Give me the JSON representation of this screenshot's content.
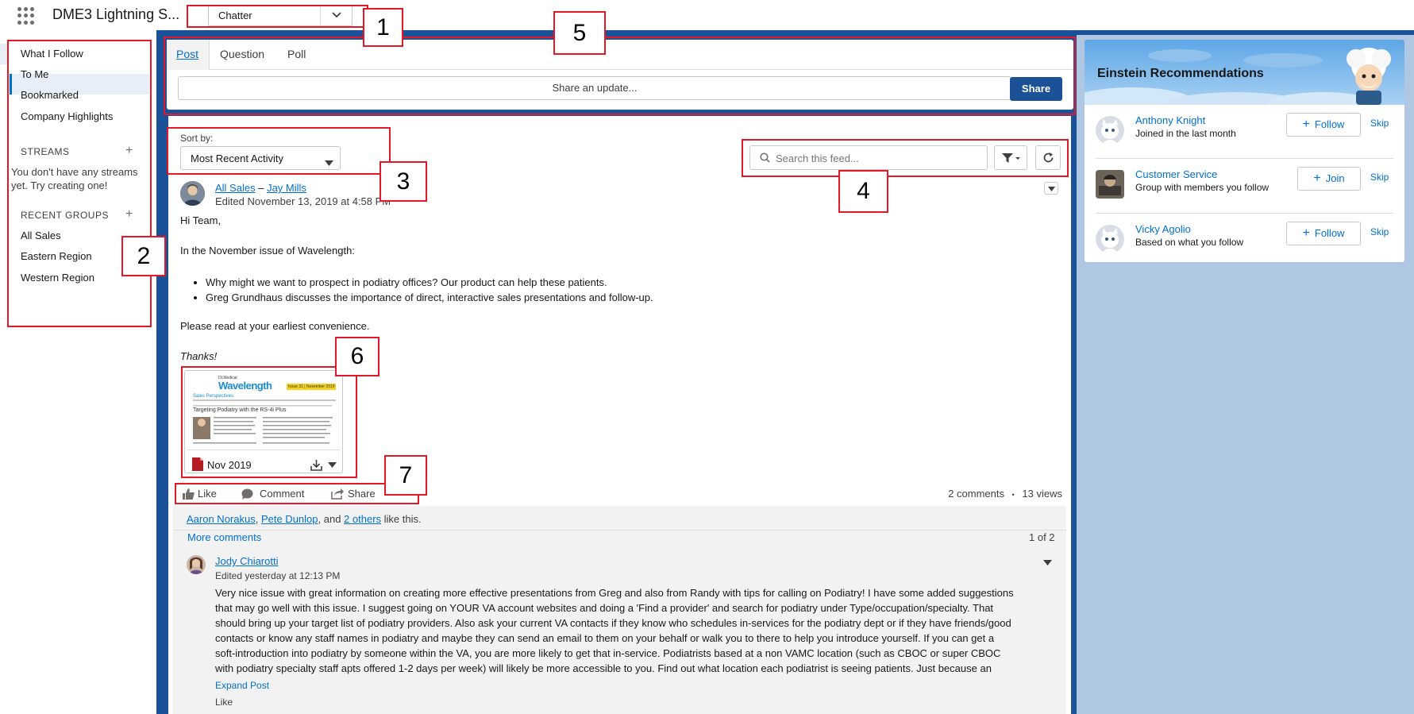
{
  "topbar": {
    "app_name": "DME3 Lightning S...",
    "nav_value": "Chatter"
  },
  "sidebar": {
    "items": [
      {
        "label": "What I Follow"
      },
      {
        "label": "To Me"
      },
      {
        "label": "Bookmarked"
      },
      {
        "label": "Company Highlights"
      }
    ],
    "streams_heading": "STREAMS",
    "streams_note": "You don't have any streams yet. Try creating one!",
    "groups_heading": "RECENT GROUPS",
    "groups": [
      {
        "label": "All Sales"
      },
      {
        "label": "Eastern Region"
      },
      {
        "label": "Western Region"
      }
    ]
  },
  "publisher": {
    "tabs": [
      {
        "label": "Post"
      },
      {
        "label": "Question"
      },
      {
        "label": "Poll"
      }
    ],
    "placeholder": "Share an update...",
    "share_label": "Share"
  },
  "feed": {
    "sort_label": "Sort by:",
    "sort_value": "Most Recent Activity",
    "search_placeholder": "Search this feed..."
  },
  "post": {
    "group": "All Sales",
    "dash": "–",
    "author": "Jay Mills",
    "edited": "Edited November 13, 2019 at 4:58 PM",
    "greeting": "Hi Team,",
    "intro": "In the November issue of Wavelength:",
    "bullets": [
      "Why might we want to prospect in podiatry offices? Our product can help these patients.",
      "Greg Grundhaus discusses the importance of direct, interactive sales presentations and follow-up."
    ],
    "closing": "Please read at your earliest convenience.",
    "thanks": "Thanks!",
    "attachment": {
      "name": "Nov 2019",
      "brand": "Wavelength",
      "company": "DLMedical",
      "issue": "Issue 31 | November 2019",
      "section": "Sales Perspectives",
      "headline": "Targeting Podiatry with the RS-4i Plus"
    },
    "actions": {
      "like": "Like",
      "comment": "Comment",
      "share": "Share"
    },
    "comments_count": "2 comments",
    "views_count": "13 views",
    "stats_sep": "•"
  },
  "likes": {
    "person1": "Aaron Norakus",
    "person2": "Pete Dunlop",
    "mid": ", and ",
    "others": "2 others",
    "suffix": " like this."
  },
  "comments": {
    "more_label": "More comments",
    "pager": "1 of 2",
    "first": {
      "author": "Jody Chiarotti",
      "edited": "Edited yesterday at 12:13 PM",
      "lines": [
        "Very nice issue with great information on creating more effective presentations from Greg and also from Randy with tips for calling on Podiatry! I have some added suggestions",
        "that may go well with this issue. I suggest going on YOUR VA account websites and doing a 'Find a provider' and search for podiatry under Type/occupation/specialty. That",
        "should bring up your target list of podiatry providers. Also ask your current VA contacts if they know who schedules in-services for the podiatry dept or if they have friends/good",
        "contacts or know any staff names in podiatry and maybe they can send an email to them on your behalf or walk you to there to help you introduce yourself. If you can get a",
        "soft-introduction into podiatry by someone within the VA, you are more likely to get that in-service. Podiatrists based at a non VAMC location (such as CBOC or super CBOC",
        "with podiatry specialty staff apts offered 1-2 days per week) will likely be more accessible to you. Find out what location each podiatrist is seeing patients. Just because an"
      ],
      "expand_label": "Expand Post",
      "like_label": "Like"
    }
  },
  "einstein": {
    "title": "Einstein Recommendations",
    "recs": [
      {
        "name": "Anthony Knight",
        "sub": "Joined in the last month",
        "action": "Follow",
        "skip": "Skip"
      },
      {
        "name": "Customer Service",
        "sub": "Group with members you follow",
        "action": "Join",
        "skip": "Skip"
      },
      {
        "name": "Vicky Agolio",
        "sub": "Based on what you follow",
        "action": "Follow",
        "skip": "Skip"
      }
    ]
  },
  "callouts": [
    "1",
    "2",
    "3",
    "4",
    "5",
    "6",
    "7"
  ],
  "colors": {
    "brand": "#1b5297",
    "link": "#0070d2",
    "annotation": "#e3192a"
  }
}
